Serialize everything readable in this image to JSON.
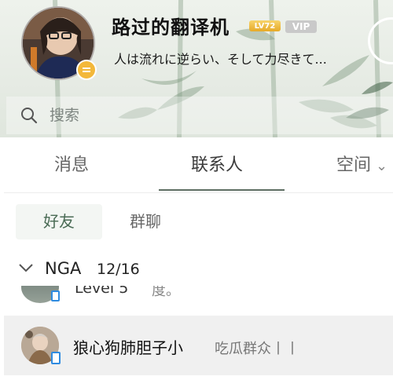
{
  "profile": {
    "nickname": "路过的翻译机",
    "level_badge": "LV72",
    "vip_badge": "VIP",
    "signature": "人は流れに逆らい、そして力尽きて..."
  },
  "search": {
    "placeholder": "搜索"
  },
  "tabs": [
    {
      "label": "消息",
      "active": false
    },
    {
      "label": "联系人",
      "active": true
    },
    {
      "label": "空间",
      "active": false
    }
  ],
  "subtabs": [
    {
      "label": "好友",
      "active": true
    },
    {
      "label": "群聊",
      "active": false
    }
  ],
  "group": {
    "name": "NGA",
    "count": "12/16"
  },
  "contacts": [
    {
      "name": "Level 5",
      "signature": "度。"
    },
    {
      "name": "狼心狗肺胆子小",
      "signature": "吃瓜群众丨丨"
    }
  ],
  "colors": {
    "accent": "#5e6e63",
    "phone_icon": "#2f8be0",
    "level_badge": "#e6a928",
    "status_badge": "#f3b83a"
  },
  "icons": {
    "search": "search-icon",
    "chevron": "chevron-down-icon",
    "phone": "phone-online-icon",
    "status": "status-away-icon"
  }
}
